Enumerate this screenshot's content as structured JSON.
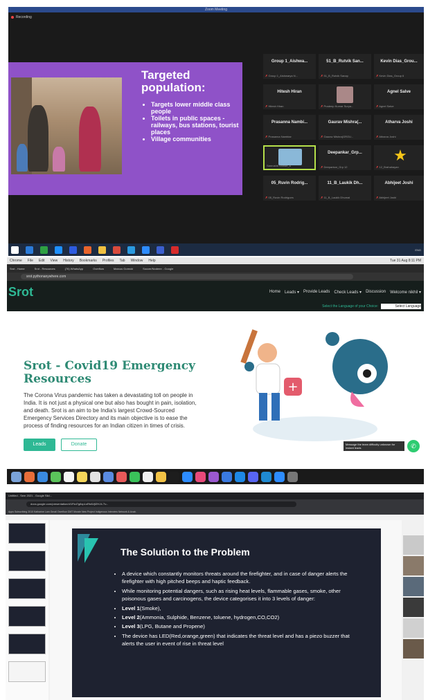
{
  "zoom": {
    "window_title": "Zoom Meeting",
    "recording": "Recording",
    "slide": {
      "heading": "Targeted population:",
      "bullets": [
        "Targets lower middle class people",
        "Toilets in public spaces - railways, bus stations, tourist places",
        "Village communities"
      ]
    },
    "participants": [
      {
        "name": "Group 1_Aishwa...",
        "sub": "Group 1_Aishwarya N..."
      },
      {
        "name": "51_B_Rutvik San...",
        "sub": "51_B_Rutvik Sanap"
      },
      {
        "name": "Kevin Dias_Grou...",
        "sub": "Kevin Dias_Group 6"
      },
      {
        "name": "Hitesh Hiran",
        "sub": "Hitesh Hiran"
      },
      {
        "name": "",
        "sub": "Pradeep Kumar Surya..."
      },
      {
        "name": "Agnel Salve",
        "sub": "Agnel Salve"
      },
      {
        "name": "Prasanna Nambi...",
        "sub": "Prasanna Nambiar"
      },
      {
        "name": "Gaurav Mishra(...",
        "sub": "Gaurav Mishra(GROU..."
      },
      {
        "name": "Atharva Joshi",
        "sub": "Atharva Joshi"
      },
      {
        "name": "",
        "sub": "Sanrushti Shinde_6"
      },
      {
        "name": "Deepankar_Grp...",
        "sub": "Deepankar_Grp 12"
      },
      {
        "name": "",
        "sub": "12_Brahahayan"
      },
      {
        "name": "05_Ruvin Rodrig...",
        "sub": "05_Ruvin Rodrigues"
      },
      {
        "name": "11_B_Laukik Dh...",
        "sub": "11_B_Laukik Dhumal"
      },
      {
        "name": "Abhijeet Joshi",
        "sub": "Abhijeet Joshi"
      }
    ],
    "clock": "ENG"
  },
  "srot": {
    "menu": [
      "Chrome",
      "File",
      "Edit",
      "View",
      "History",
      "Bookmarks",
      "Profiles",
      "Tab",
      "Window",
      "Help"
    ],
    "menu_time": "Tue 31 Aug 8:11 PM",
    "tabs": [
      "Srot - Home",
      "Srot - Resources",
      "(76) WhatsApp",
      "Overflow",
      "Marcus Gorecki",
      "Soccer/Nodemr - Google"
    ],
    "url": "srot.pythonanywhere.com",
    "logo": "Srot",
    "nav": [
      "Home",
      "Leads ▾",
      "Provide Leads",
      "Check Leads ▾",
      "Discussion",
      "Welcome nikhil ▾"
    ],
    "lang_prompt": "Select the Language of your Choice:",
    "lang_select": "Select Language",
    "title": "Srot - Covid19 Emergency Resources",
    "body": "The Corona Virus pandemic has taken a devastating toll on people in India. It is not just a physical one but also has bought in pain, isolation, and death. Srot is an aim to be India's largest Crowd-Sourced Emergency Services Directory and its main objective is to ease the process of finding resources for an Indian citizen in times of crisis.",
    "btn_leads": "Leads",
    "btn_donate": "Donate",
    "chat_bubble": "Message the team difficulty unknown for instant leads"
  },
  "slides": {
    "tab_title": "Untitled - Sem 2021 - Google Slid...",
    "url": "docs.google.com/presentation/d/1Fkd7g8xpLsRbAVjfZHJ4-Tv...",
    "bookmarks": "Apps   Subscribing   2010   Katharine Lam   Gmail   Overflow   GMT Morale   New Project   Indigenous   Interview   Network & Avab.",
    "title": "The Solution to the Problem",
    "items": [
      {
        "bold": "",
        "text": "A device which constantly monitors threats around the firefighter, and in case of danger alerts the firefighter with high pitched beeps and haptic feedback."
      },
      {
        "bold": "",
        "text": "While monitoring potential dangers, such as rising heat levels, flammable gases, smoke, other poisonous gases and carcinogens, the device categorises it into 3 levels of danger:"
      },
      {
        "bold": "Level 1",
        "text": "(Smoke),"
      },
      {
        "bold": "Level 2",
        "text": "(Ammonia, Sulphide, Benzene, toluene, hydrogen,CO,CO2)"
      },
      {
        "bold": "Level 3",
        "text": "(LPG, Butane and Propene)"
      },
      {
        "bold": "",
        "text": "The device has LED(Red,orange,green) that indicates the threat level and has a piezo buzzer that alerts the user in event of rise in threat level"
      }
    ]
  }
}
